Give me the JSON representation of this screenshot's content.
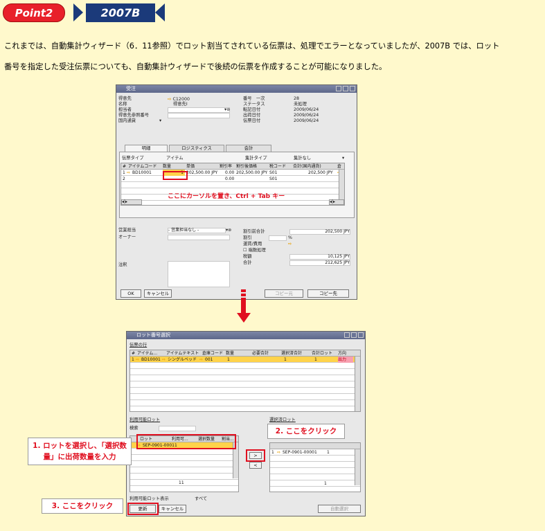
{
  "header": {
    "point_label": "Point2",
    "version_label": "2007B"
  },
  "intro": {
    "line1": "これまでは、自動集計ウィザード（6．11参照）でロット割当てされている伝票は、処理でエラーとなっていましたが、2007B では、ロット",
    "line2": "番号を指定した受注伝票についても、自動集計ウィザードで後続の伝票を作成することが可能になりました。"
  },
  "order_window": {
    "title": "受注",
    "left_labels": [
      "得意先",
      "名称",
      "担当者",
      "得意先参照番号",
      "国内通貨"
    ],
    "customer_code": "C12000",
    "customer_name": "得意先I",
    "right_labels": [
      "番号",
      "ステータス",
      "転記日付",
      "出荷日付",
      "伝票日付"
    ],
    "number_type": "一次",
    "number": "28",
    "status": "未処理",
    "posting_date": "2009/06/24",
    "delivery_date": "2009/06/24",
    "doc_date": "2009/06/24",
    "tabs": [
      "明細",
      "ロジスティクス",
      "会計"
    ],
    "item_type_label": "伝票タイプ",
    "item_type_value": "アイテム",
    "summary_type_label": "集計タイプ",
    "summary_type_value": "集計なし",
    "columns": [
      "#",
      "アイテムコード",
      "数量",
      "単価",
      "割引率",
      "割引後価格",
      "税コード",
      "合計(国内通貨)",
      "倉"
    ],
    "rows": [
      {
        "no": "1",
        "code": "BD10001",
        "qty": "1",
        "price": "202,500.00 JPY",
        "discount": "0.00",
        "after": "202,500.00 JPY",
        "tax": "S01",
        "total": "202,500 JPY"
      },
      {
        "no": "2",
        "code": "",
        "qty": "",
        "price": "",
        "discount": "0.00",
        "after": "",
        "tax": "S01",
        "total": ""
      }
    ],
    "sales_rep_label": "営業担当",
    "sales_rep_value": "- 営業担当なし -",
    "owner_label": "オーナー",
    "remarks_label": "注釈",
    "totals_labels": [
      "割引前合計",
      "割引",
      "運賃/費用",
      "端数処理",
      "税額",
      "合計"
    ],
    "subtotal": "202,500 JPY",
    "discount_unit": "%",
    "tax_total": "10,125 JPY",
    "grand_total": "212,625 JPY",
    "btn_ok": "OK",
    "btn_cancel": "キャンセル",
    "btn_copy_from": "コピー元",
    "btn_copy_to": "コピー先"
  },
  "cursor_instruction": "ここにカーソルを置き、Ctrl + Tab キー",
  "lot_window": {
    "title": "ロット番号選択",
    "doc_rows_label": "伝票の行",
    "columns": [
      "#",
      "アイテム...",
      "アイテムテキスト",
      "倉庫コード",
      "数量",
      "必要合計",
      "選択済合計",
      "合計ロット",
      "方向"
    ],
    "row": {
      "no": "1",
      "code": "BD10001",
      "text": "シングルベッド",
      "whs": "001",
      "qty": "1",
      "selected": "1",
      "lots": "1",
      "dir": "出力"
    },
    "available_label": "利用可能ロット",
    "search_label": "検索",
    "available_cols": [
      "ロット",
      "利用可...",
      "選択数量",
      "割当..."
    ],
    "available_row": "SEP-0901-00011",
    "available_count": "11",
    "selected_label": "選択済ロット",
    "selected_row_no": "1",
    "selected_row": "SEP-0901-00001",
    "selected_qty": "1",
    "selected_count": "1",
    "show_label": "利用可能ロット表示",
    "show_value": "すべて",
    "btn_update": "更新",
    "btn_cancel": "キャンセル",
    "btn_auto": "自動選択",
    "btn_add": ">",
    "btn_remove": "<"
  },
  "callouts": {
    "c1": "1. ロットを選択し、「選択数量」に出荷数量を入力",
    "c2": "2. ここをクリック",
    "c3": "3. ここをクリック"
  },
  "colors": {
    "accent_red": "#e01020",
    "navy": "#1b3a7a",
    "selected_row": "#ffd34a",
    "page_bg": "#fff9cc"
  }
}
